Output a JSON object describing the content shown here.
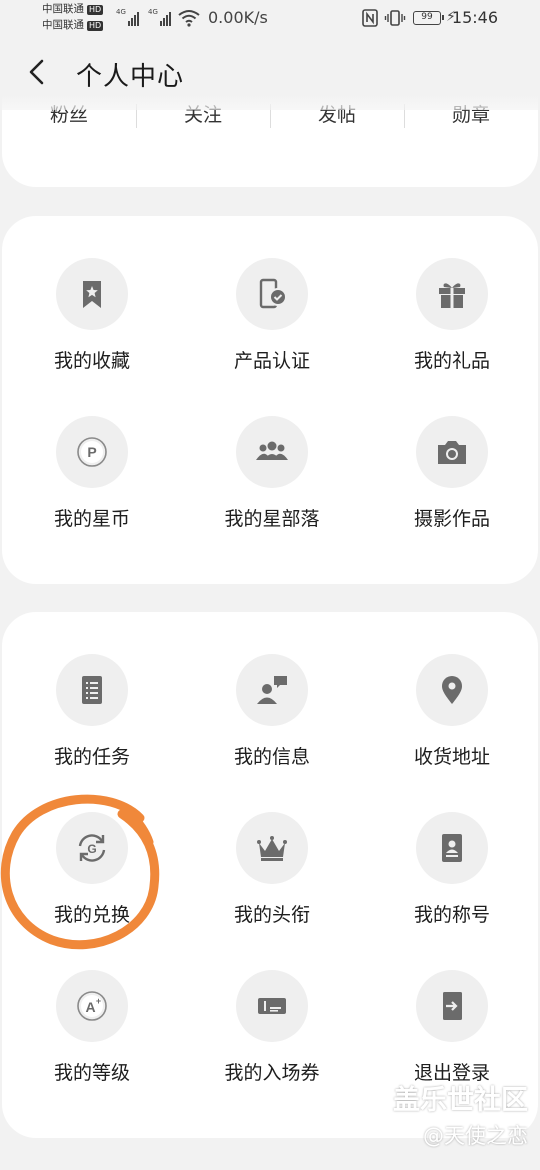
{
  "statusbar": {
    "carrier1": "中国联通",
    "carrier2": "中国联通",
    "hd": "HD",
    "net_type": "4G",
    "speed": "0.00K/s",
    "battery": "99",
    "time": "15:46"
  },
  "header": {
    "title": "个人中心",
    "back_icon": "chevron-left-icon"
  },
  "stats": [
    "粉丝",
    "关注",
    "发帖",
    "勋章"
  ],
  "grid1": [
    {
      "label": "我的收藏",
      "icon": "bookmark-star-icon"
    },
    {
      "label": "产品认证",
      "icon": "phone-check-icon"
    },
    {
      "label": "我的礼品",
      "icon": "gift-icon"
    },
    {
      "label": "我的星币",
      "icon": "coin-p-icon"
    },
    {
      "label": "我的星部落",
      "icon": "group-icon"
    },
    {
      "label": "摄影作品",
      "icon": "camera-icon"
    }
  ],
  "grid2": [
    {
      "label": "我的任务",
      "icon": "task-list-icon"
    },
    {
      "label": "我的信息",
      "icon": "person-message-icon"
    },
    {
      "label": "收货地址",
      "icon": "location-pin-icon"
    },
    {
      "label": "我的兑换",
      "icon": "exchange-g-icon"
    },
    {
      "label": "我的头衔",
      "icon": "crown-icon"
    },
    {
      "label": "我的称号",
      "icon": "id-card-icon"
    },
    {
      "label": "我的等级",
      "icon": "level-a-plus-icon"
    },
    {
      "label": "我的入场券",
      "icon": "ticket-icon"
    },
    {
      "label": "退出登录",
      "icon": "logout-icon"
    }
  ],
  "annotation_color": "#f0883a",
  "watermark": {
    "line1": "盖乐世社区",
    "line2": "@天使之恋"
  }
}
